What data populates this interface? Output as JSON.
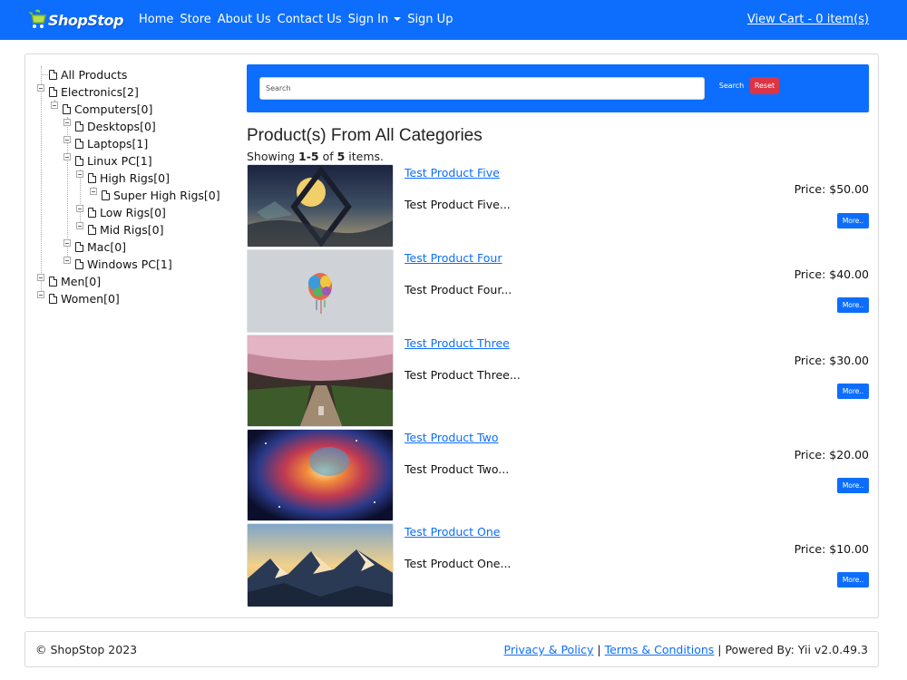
{
  "navbar": {
    "brand": "ShopStop",
    "links": [
      "Home",
      "Store",
      "About Us",
      "Contact Us",
      "Sign In",
      "Sign Up"
    ],
    "cart": "View Cart - 0 item(s)",
    "color": "#0d6efd"
  },
  "tree": {
    "items": [
      {
        "label": "All Products"
      },
      {
        "label": "Electronics[2]"
      },
      {
        "label": "Computers[0]"
      },
      {
        "label": "Desktops[0]"
      },
      {
        "label": "Laptops[1]"
      },
      {
        "label": "Linux PC[1]"
      },
      {
        "label": "High Rigs[0]"
      },
      {
        "label": "Super High Rigs[0]"
      },
      {
        "label": "Low Rigs[0]"
      },
      {
        "label": "Mid Rigs[0]"
      },
      {
        "label": "Mac[0]"
      },
      {
        "label": "Windows PC[1]"
      },
      {
        "label": "Men[0]"
      },
      {
        "label": "Women[0]"
      }
    ]
  },
  "search": {
    "placeholder": "Search",
    "search_label": "Search",
    "reset_label": "Reset"
  },
  "heading": "Product(s) From All Categories",
  "summary": {
    "prefix": "Showing ",
    "range": "1-5",
    "of": " of ",
    "total": "5",
    "suffix": " items."
  },
  "products": [
    {
      "title": "Test Product Five",
      "desc": "Test Product Five...",
      "price": "Price: $50.00",
      "more": "More..",
      "image": "abstract-planet"
    },
    {
      "title": "Test Product Four",
      "desc": "Test Product Four...",
      "price": "Price: $40.00",
      "more": "More..",
      "image": "colorful-brain"
    },
    {
      "title": "Test Product Three",
      "desc": "Test Product Three...",
      "price": "Price: $30.00",
      "more": "More..",
      "image": "cherry-blossom-path"
    },
    {
      "title": "Test Product Two",
      "desc": "Test Product Two...",
      "price": "Price: $20.00",
      "more": "More..",
      "image": "nebula"
    },
    {
      "title": "Test Product One",
      "desc": "Test Product One...",
      "price": "Price: $10.00",
      "more": "More..",
      "image": "mountain-sunset"
    }
  ],
  "footer": {
    "copyright": "© ShopStop 2023",
    "privacy": "Privacy & Policy",
    "sep": " | ",
    "terms": "Terms & Conditions",
    "powered": " | Powered By: Yii v2.0.49.3"
  }
}
